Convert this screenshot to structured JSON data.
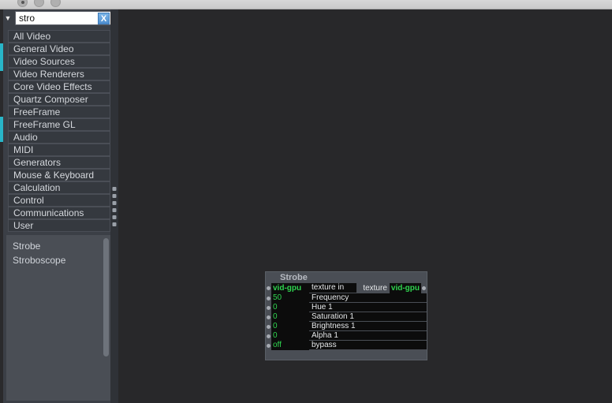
{
  "window": {
    "traffic_lights": [
      "close",
      "minimize",
      "zoom"
    ]
  },
  "toolbar": {
    "disclosure_icon": "triangle-down-icon",
    "search": {
      "value": "stro",
      "placeholder": "",
      "clear_label": "X",
      "clear_icon": "clear-search-icon"
    },
    "camera_icon": "camera-icon",
    "camera_arrow_icon": "play-arrow-icon"
  },
  "sidebar": {
    "categories": [
      {
        "label": "All Video"
      },
      {
        "label": "General Video"
      },
      {
        "label": "Video Sources"
      },
      {
        "label": "Video Renderers"
      },
      {
        "label": "Core Video Effects"
      },
      {
        "label": "Quartz Composer"
      },
      {
        "label": "FreeFrame"
      },
      {
        "label": "FreeFrame GL"
      },
      {
        "label": "Audio"
      },
      {
        "label": "MIDI"
      },
      {
        "label": "Generators"
      },
      {
        "label": "Mouse & Keyboard"
      },
      {
        "label": "Calculation"
      },
      {
        "label": "Control"
      },
      {
        "label": "Communications"
      },
      {
        "label": "User"
      }
    ],
    "results": [
      {
        "label": "Strobe"
      },
      {
        "label": "Stroboscope"
      }
    ]
  },
  "splitter": {
    "handle_icon": "drag-handle-icon",
    "dot_count": 6
  },
  "node": {
    "title": "Strobe",
    "io_row": {
      "input_value": "vid-gpu",
      "input_label": "texture in",
      "output_label": "texture out",
      "output_value": "vid-gpu"
    },
    "params": [
      {
        "value": "50",
        "label": "Frequency"
      },
      {
        "value": "0",
        "label": "Hue 1"
      },
      {
        "value": "0",
        "label": "Saturation 1"
      },
      {
        "value": "0",
        "label": "Brightness 1"
      },
      {
        "value": "0",
        "label": "Alpha 1"
      },
      {
        "value": "off",
        "label": "bypass"
      }
    ]
  },
  "colors": {
    "accent_cyan": "#28b5c8",
    "value_green": "#2fd44f",
    "panel_bg": "#3b3f46",
    "canvas_bg": "#28282a",
    "node_bg": "#4a4e55",
    "clear_button_blue": "#4f8fd0"
  }
}
